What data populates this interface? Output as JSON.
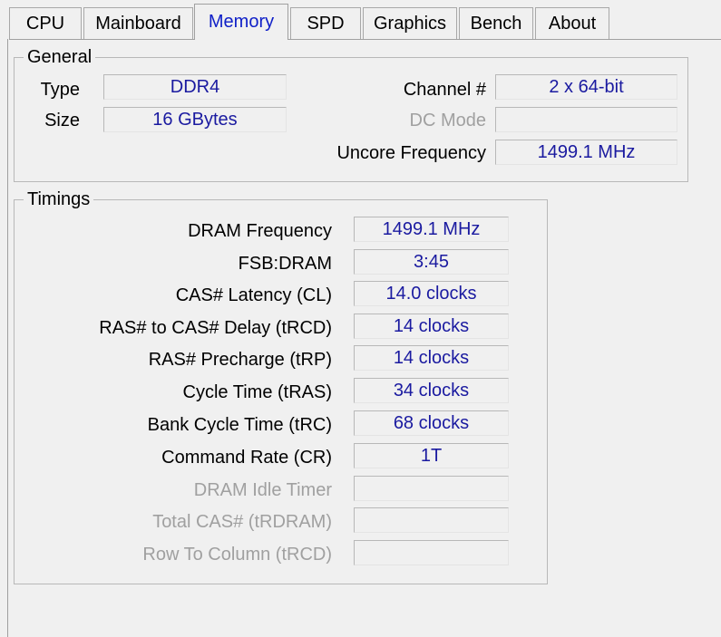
{
  "tabs": [
    "CPU",
    "Mainboard",
    "Memory",
    "SPD",
    "Graphics",
    "Bench",
    "About"
  ],
  "active_tab": "Memory",
  "general": {
    "title": "General",
    "type_label": "Type",
    "type_value": "DDR4",
    "size_label": "Size",
    "size_value": "16 GBytes",
    "channel_label": "Channel #",
    "channel_value": "2 x 64-bit",
    "dc_mode_label": "DC Mode",
    "dc_mode_value": "",
    "uncore_label": "Uncore Frequency",
    "uncore_value": "1499.1 MHz"
  },
  "timings": {
    "title": "Timings",
    "rows": [
      {
        "label": "DRAM Frequency",
        "value": "1499.1 MHz",
        "enabled": true
      },
      {
        "label": "FSB:DRAM",
        "value": "3:45",
        "enabled": true
      },
      {
        "label": "CAS# Latency (CL)",
        "value": "14.0 clocks",
        "enabled": true
      },
      {
        "label": "RAS# to CAS# Delay (tRCD)",
        "value": "14 clocks",
        "enabled": true
      },
      {
        "label": "RAS# Precharge (tRP)",
        "value": "14 clocks",
        "enabled": true
      },
      {
        "label": "Cycle Time (tRAS)",
        "value": "34 clocks",
        "enabled": true
      },
      {
        "label": "Bank Cycle Time (tRC)",
        "value": "68 clocks",
        "enabled": true
      },
      {
        "label": "Command Rate (CR)",
        "value": "1T",
        "enabled": true
      },
      {
        "label": "DRAM Idle Timer",
        "value": "",
        "enabled": false
      },
      {
        "label": "Total CAS# (tRDRAM)",
        "value": "",
        "enabled": false
      },
      {
        "label": "Row To Column (tRCD)",
        "value": "",
        "enabled": false
      }
    ]
  }
}
